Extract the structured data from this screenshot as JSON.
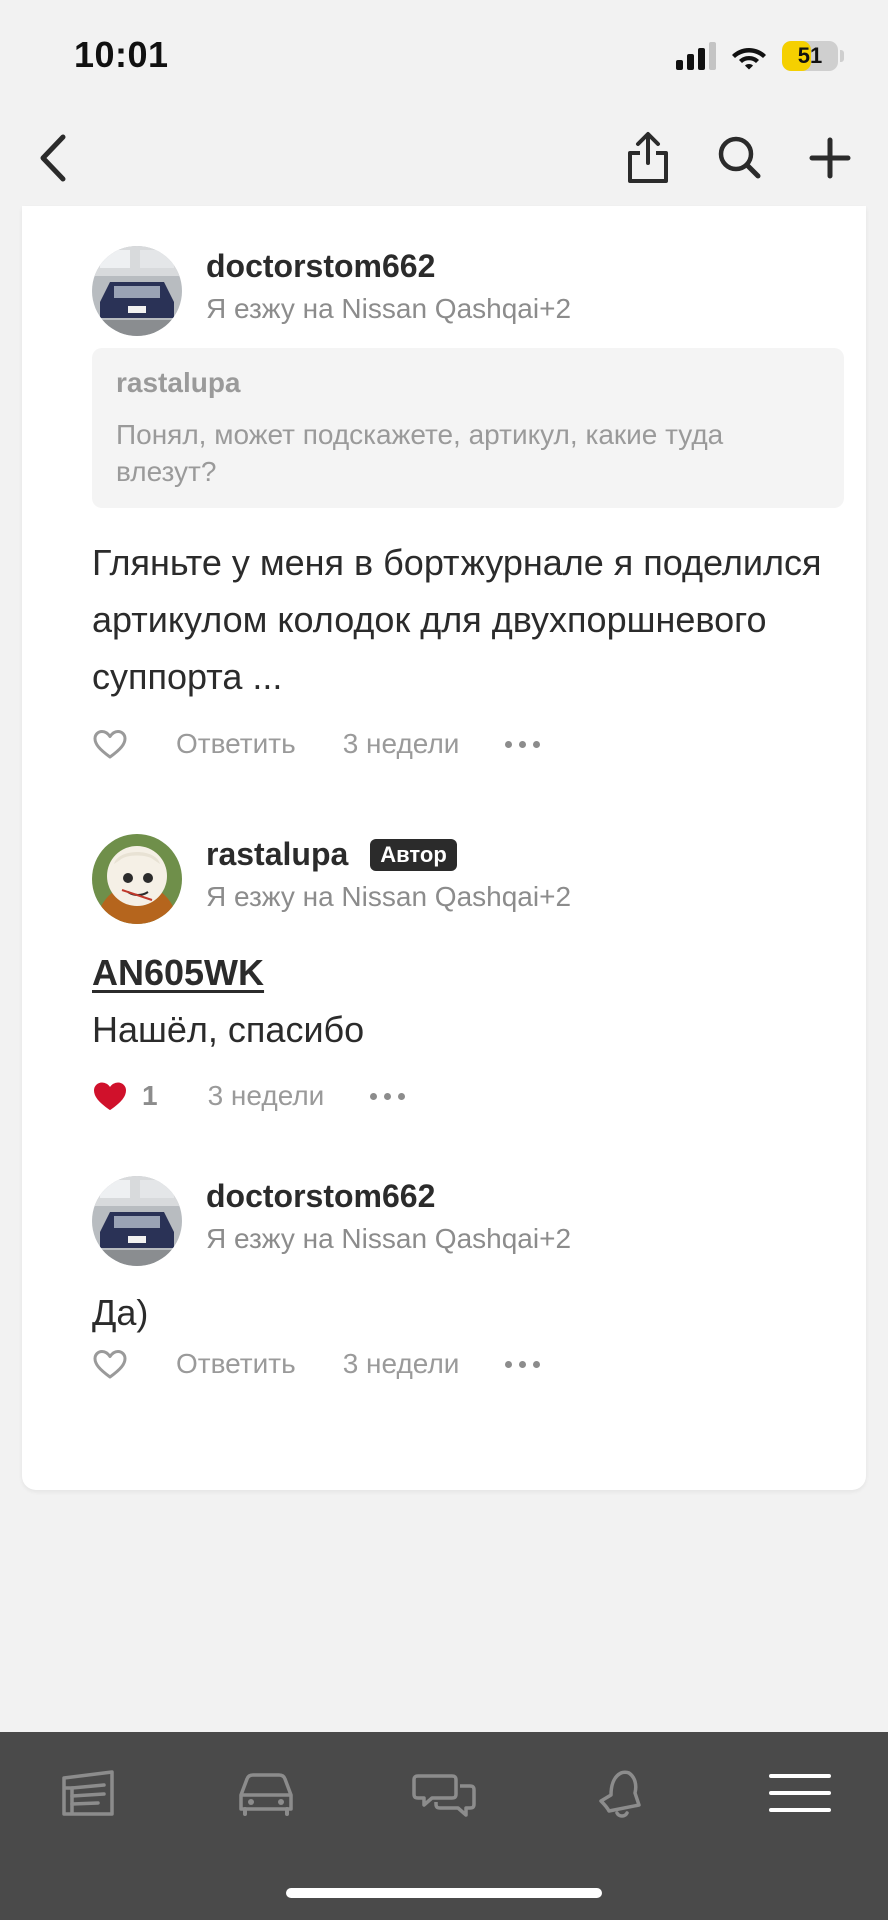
{
  "status": {
    "time": "10:01",
    "battery": "51",
    "battery_level": 0.51
  },
  "nav": {
    "back": "back-arrow-icon",
    "share": "share-icon",
    "search": "search-icon",
    "add": "plus-icon"
  },
  "comments": [
    {
      "username": "doctorstom662",
      "drive": "Я езжу на Nissan Qashqai+2",
      "quote_user": "rastalupa",
      "quote_text": "Понял, может подскажете, артикул, какие туда влезут?",
      "text": "Гляньте у меня в бортжурнале я поделился артикулом колодок для двухпоршневого суппорта ...",
      "reply": "Ответить",
      "time": "3 недели",
      "liked": false
    },
    {
      "username": "rastalupa",
      "badge": "Автор",
      "drive": "Я езжу на Nissan Qashqai+2",
      "code": "AN605WK",
      "text": "Нашёл, спасибо",
      "likes": "1",
      "time": "3 недели",
      "liked": true
    },
    {
      "username": "doctorstom662",
      "drive": "Я езжу на Nissan Qashqai+2",
      "text": "Да)",
      "reply": "Ответить",
      "time": "3 недели",
      "liked": false
    }
  ],
  "tabbar": [
    "feed-icon",
    "car-icon",
    "chats-icon",
    "notifications-icon",
    "menu-icon"
  ],
  "colors": {
    "like": "#d0112b",
    "tabbar": "#4a4a4a",
    "badge": "#2b2b2b",
    "battery": "#f5d000"
  }
}
